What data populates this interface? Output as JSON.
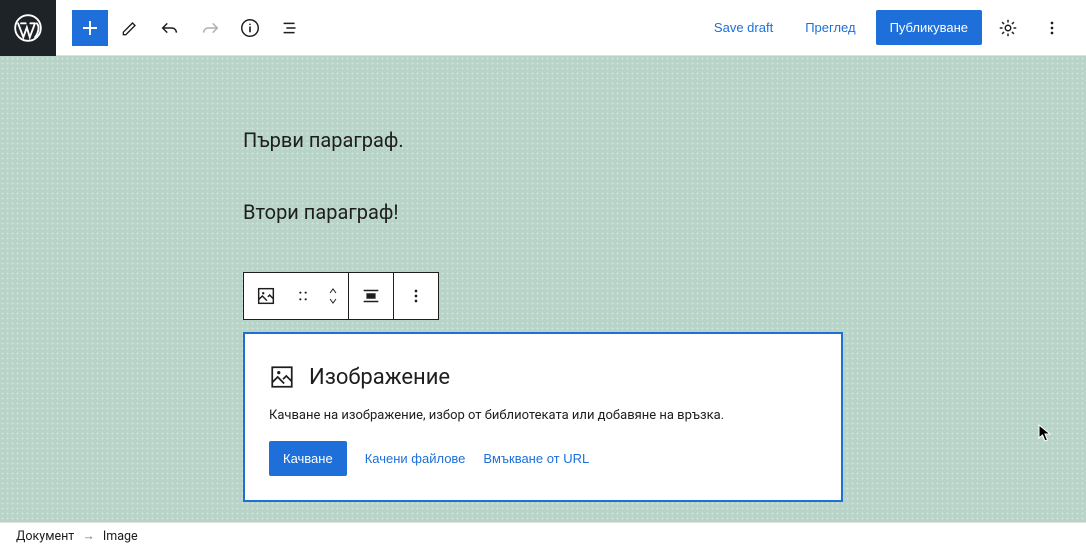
{
  "header": {
    "save_draft": "Save draft",
    "preview": "Преглед",
    "publish": "Публикуване"
  },
  "content": {
    "para1": "Първи параграф.",
    "para2": "Втори параграф!"
  },
  "image_block": {
    "title": "Изображение",
    "description": "Качване на изображение, избор от библиотеката или добавяне на връзка.",
    "upload": "Качване",
    "media_library": "Качени файлове",
    "from_url": "Вмъкване от URL"
  },
  "breadcrumb": {
    "doc": "Документ",
    "block": "Image"
  }
}
